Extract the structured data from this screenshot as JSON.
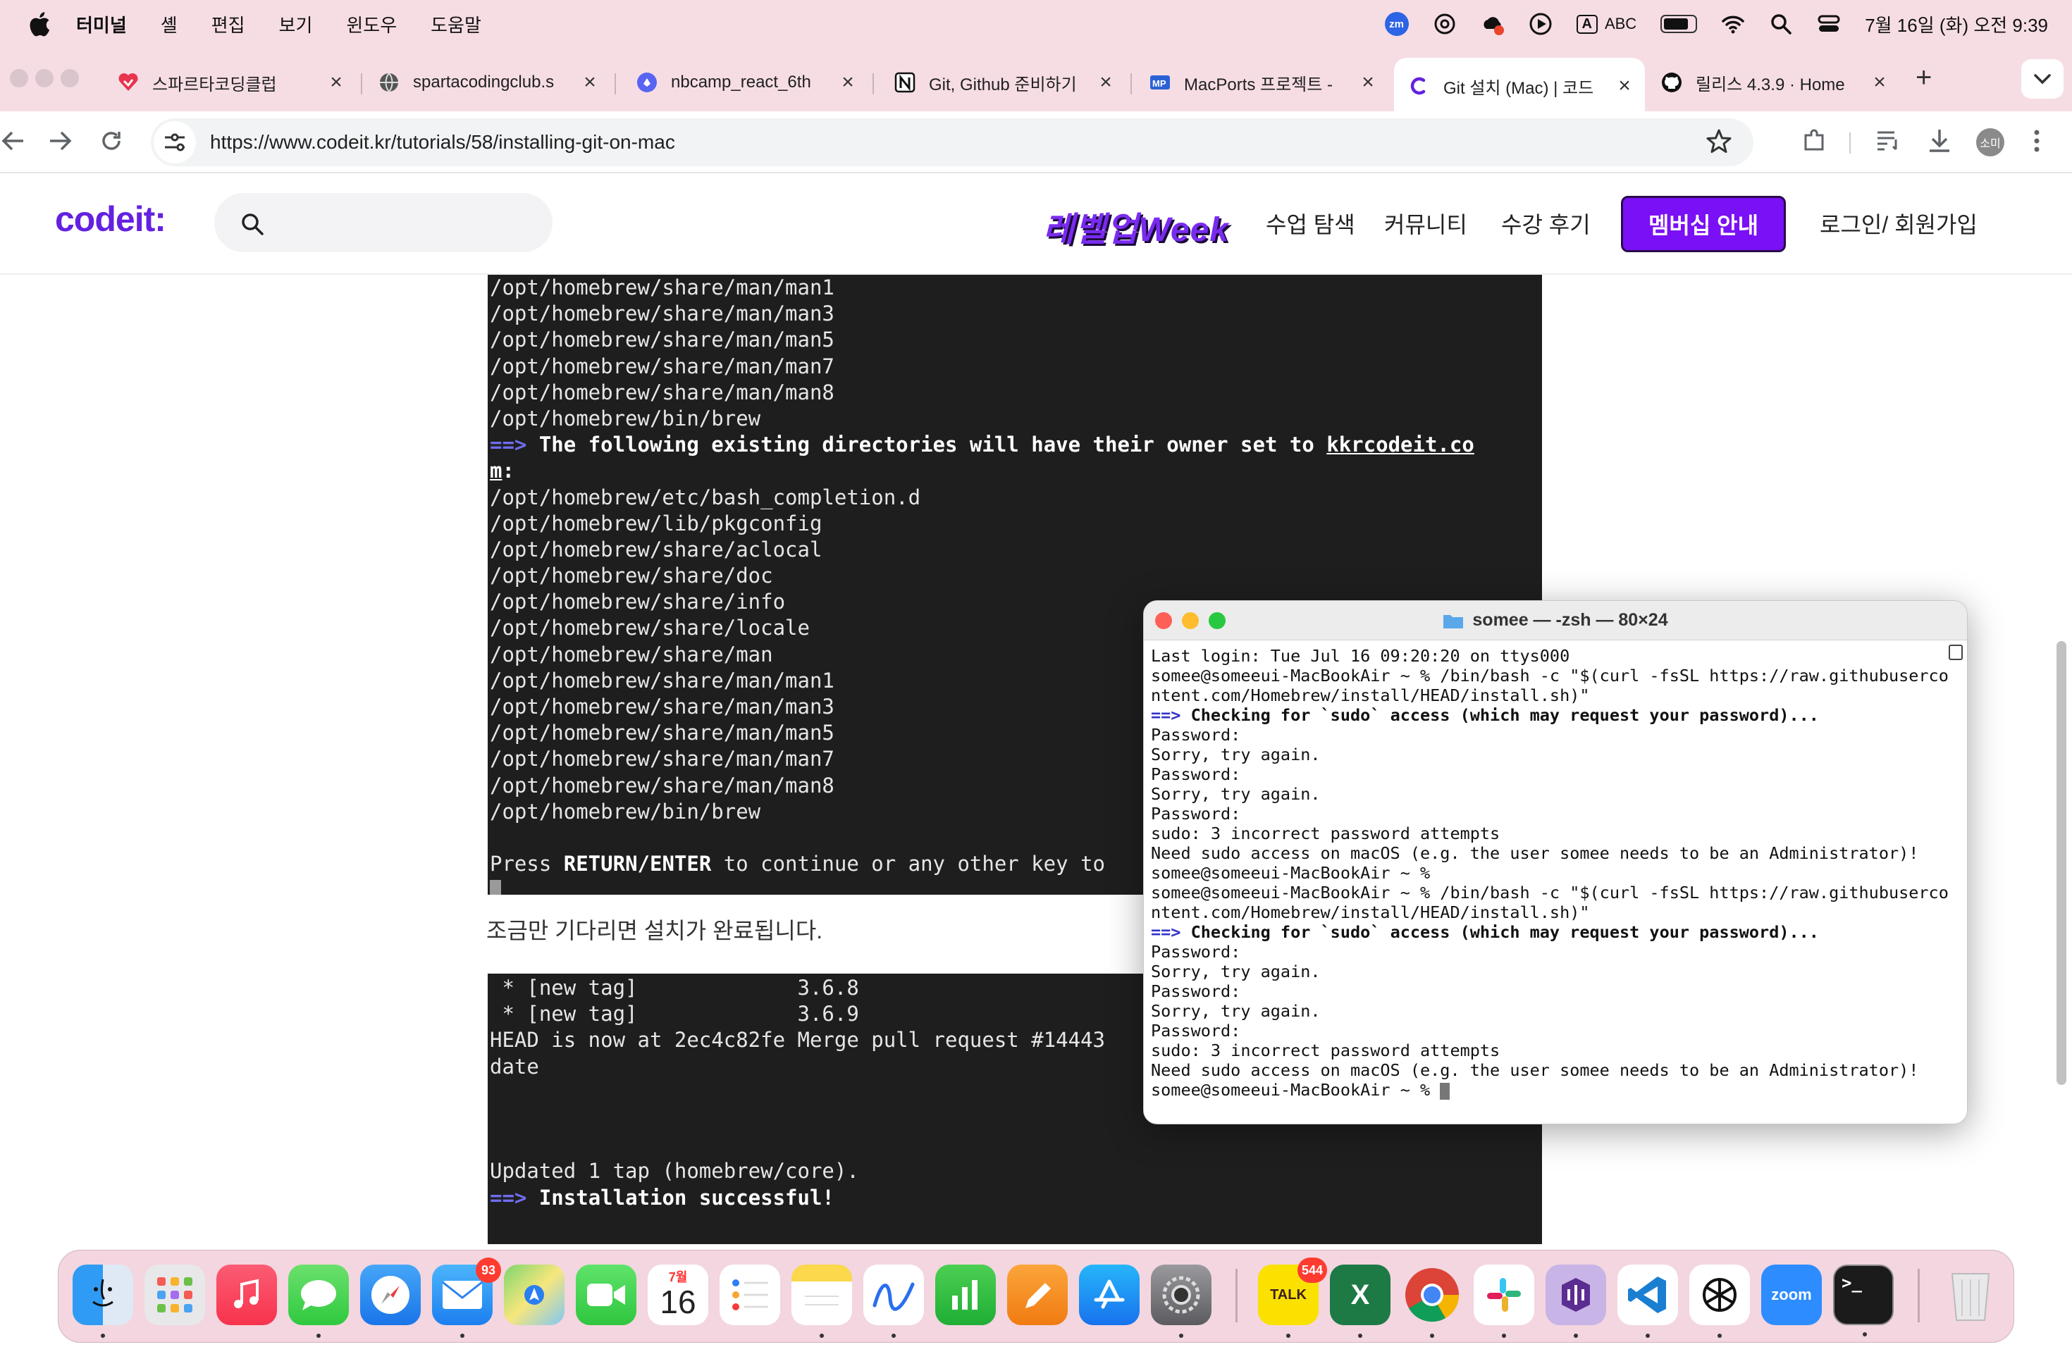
{
  "menubar": {
    "items": [
      "터미널",
      "셸",
      "편집",
      "보기",
      "윈도우",
      "도움말"
    ],
    "input_source": "ABC",
    "clock": "7월 16일 (화) 오전 9:39",
    "zoom_badge": "zm"
  },
  "tabs": [
    {
      "label": "스파르타코딩클럽",
      "icon": "heart-logo-icon"
    },
    {
      "label": "spartacodingclub.s",
      "icon": "globe-icon"
    },
    {
      "label": "nbcamp_react_6th",
      "icon": "discord-icon"
    },
    {
      "label": "Git, Github 준비하기",
      "icon": "notion-icon"
    },
    {
      "label": "MacPorts 프로젝트 -",
      "icon": "macports-icon"
    },
    {
      "label": "Git 설치 (Mac) | 코드",
      "icon": "codeit-icon",
      "active": true
    },
    {
      "label": "릴리스 4.3.9 · Home",
      "icon": "github-icon"
    }
  ],
  "address": {
    "url": "https://www.codeit.kr/tutorials/58/installing-git-on-mac",
    "profile": "소미"
  },
  "site": {
    "logo": "codeit:",
    "promo": "레벨업Week",
    "nav": [
      "수업 탐색",
      "커뮤니티",
      "수강 후기"
    ],
    "member_button": "멤버십 안내",
    "login": "로그인/ 회원가입"
  },
  "content": {
    "block1": [
      "/opt/homebrew/share/man/man1",
      "/opt/homebrew/share/man/man3",
      "/opt/homebrew/share/man/man5",
      "/opt/homebrew/share/man/man7",
      "/opt/homebrew/share/man/man8",
      "/opt/homebrew/bin/brew"
    ],
    "owner_prefix": "==>",
    "owner_text": " The following existing directories will have their owner set to ",
    "owner_user_a": "kkrcodeit.co",
    "owner_user_b": "m",
    "owner_colon": ":",
    "block2": [
      "/opt/homebrew/etc/bash_completion.d",
      "/opt/homebrew/lib/pkgconfig",
      "/opt/homebrew/share/aclocal",
      "/opt/homebrew/share/doc",
      "/opt/homebrew/share/info",
      "/opt/homebrew/share/locale",
      "/opt/homebrew/share/man",
      "/opt/homebrew/share/man/man1",
      "/opt/homebrew/share/man/man3",
      "/opt/homebrew/share/man/man5",
      "/opt/homebrew/share/man/man7",
      "/opt/homebrew/share/man/man8",
      "/opt/homebrew/bin/brew"
    ],
    "press_a": "Press ",
    "press_b": "RETURN/ENTER",
    "press_c": " to continue or any other key to",
    "caption": "조금만 기다리면 설치가 완료됩니다.",
    "block3": [
      " * [new tag]             3.6.8                          -",
      " * [new tag]             3.6.9                          -",
      "HEAD is now at 2ec4c82fe Merge pull request #14443",
      "date"
    ],
    "updated": "Updated 1 tap (homebrew/core).",
    "success_prefix": "==>",
    "success_text": " Installation successful!"
  },
  "terminal": {
    "title": "somee — -zsh — 80×24",
    "last_login": "Last login: Tue Jul 16 09:20:20 on ttys000",
    "cmd_1": "somee@someeui-MacBookAir ~ % /bin/bash -c \"$(curl -fsSL https://raw.githubuserco",
    "cmd_2": "ntent.com/Homebrew/install/HEAD/install.sh)\"",
    "check_prefix": "==>",
    "check_text": " Checking for `sudo` access (which may request your password)...",
    "password": "Password:",
    "sorry": "Sorry, try again.",
    "incorrect": "sudo: 3 incorrect password attempts",
    "need_sudo": "Need sudo access on macOS (e.g. the user somee needs to be an Administrator)!",
    "prompt": "somee@someeui-MacBookAir ~ %"
  },
  "dock": {
    "apps": [
      "Finder",
      "Launchpad",
      "Music",
      "Messages",
      "Safari",
      "Mail",
      "Maps",
      "FaceTime",
      "Calendar",
      "Reminders",
      "Notes",
      "Freeform",
      "Numbers",
      "Pages",
      "App Store",
      "System Settings",
      "KakaoTalk",
      "Excel",
      "Chrome",
      "Slack",
      "Visual Studio",
      "VS Code",
      "ChatGPT",
      "Zoom",
      "Terminal",
      "Trash"
    ],
    "mail_badge": "93",
    "kakao_badge": "544",
    "calendar_month": "7월",
    "calendar_day": "16",
    "kakao_label": "TALK",
    "excel_label": "X",
    "zoom_label": "zoom",
    "terminal_label": ">_"
  }
}
